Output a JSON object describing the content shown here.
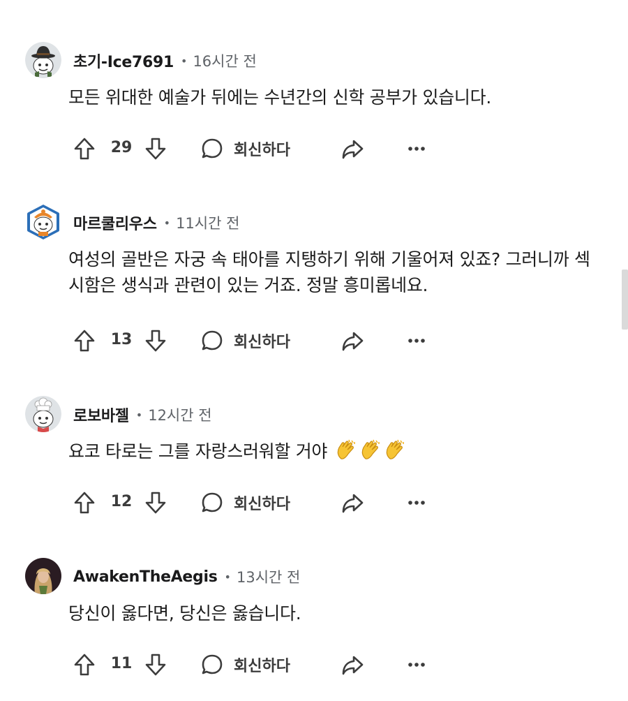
{
  "comments": [
    {
      "author": "초기-Ice7691",
      "time": "16시간 전",
      "text": "모든 위대한 예술가 뒤에는 수년간의 신학 공부가 있습니다.",
      "score": "29",
      "reply_label": "회신하다",
      "avatar_icon": "snoo-cowboy-hat-avatar"
    },
    {
      "author": "마르쿨리우스",
      "time": "11시간 전",
      "text": "여성의 골반은 자궁 속 태아를 지탱하기 위해 기울어져 있죠? 그러니까 섹시함은 생식과 관련이 있는 거죠. 정말 흥미롭네요.",
      "score": "13",
      "reply_label": "회신하다",
      "avatar_icon": "snoo-hexagon-avatar"
    },
    {
      "author": "로보바젤",
      "time": "12시간 전",
      "text": "요코 타로는 그를 자랑스러워할 거야",
      "score": "12",
      "reply_label": "회신하다",
      "avatar_icon": "snoo-chef-avatar",
      "emojis": [
        "clapping-hands-emoji",
        "clapping-hands-emoji",
        "clapping-hands-emoji"
      ]
    },
    {
      "author": "AwakenTheAegis",
      "time": "13시간 전",
      "text": "당신이 옳다면, 당신은 옳습니다.",
      "score": "11",
      "reply_label": "회신하다",
      "avatar_icon": "photo-avatar"
    }
  ],
  "colors": {
    "text": "#1a1a1b",
    "meta": "#5f6368",
    "icon": "#3c3c3c",
    "scrollbar": "#dadada"
  }
}
